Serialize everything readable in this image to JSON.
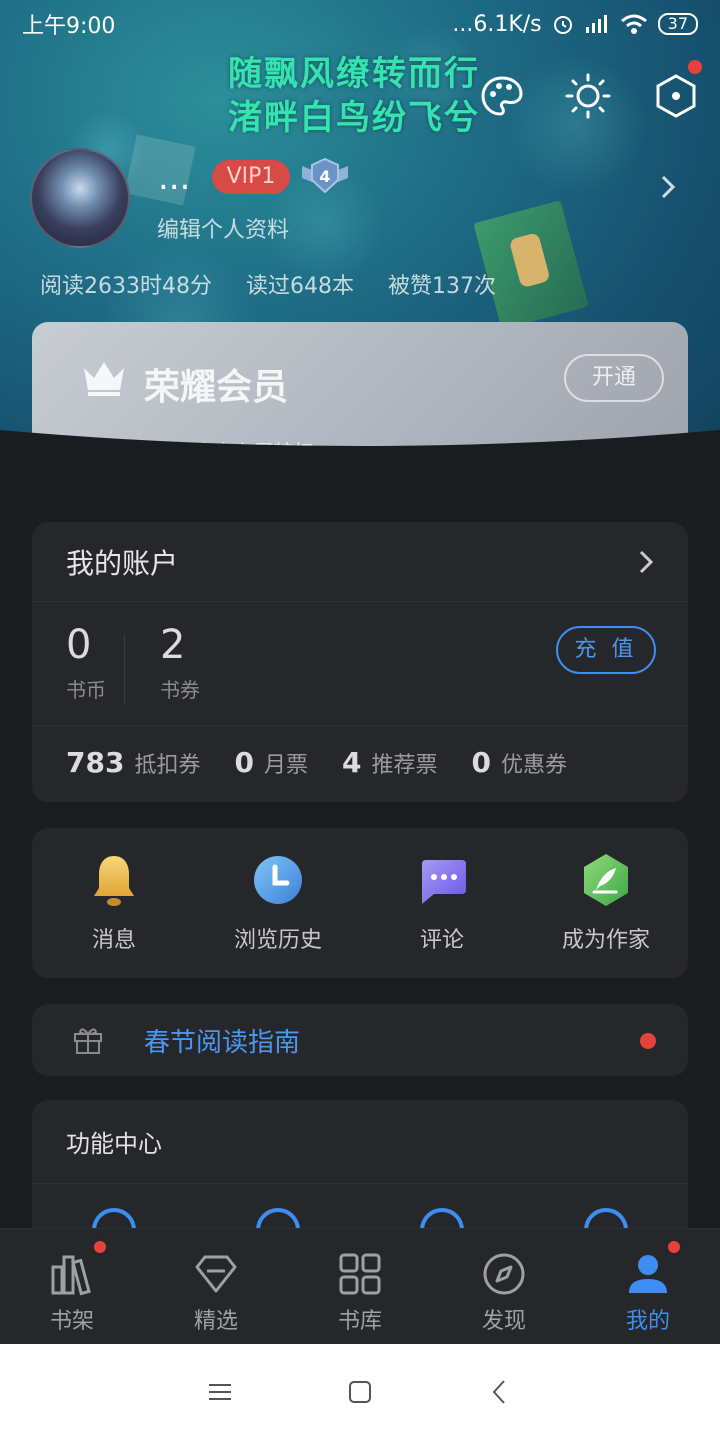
{
  "status": {
    "time": "上午9:00",
    "network": "...6.1K/s",
    "battery": "37"
  },
  "hero": {
    "poem_line1": "随飘风缭转而行",
    "poem_line2": "渚畔白鸟纷飞兮",
    "username": "...",
    "vip_label": "VIP1",
    "level": "4",
    "edit_profile": "编辑个人资料",
    "stats": {
      "read_time": "阅读2633时48分",
      "books_read": "读过648本",
      "likes": "被赞137次"
    }
  },
  "vip_card": {
    "title": "荣耀会员",
    "subtitle": "尊享QQ阅读十大专属特权",
    "button": "开通"
  },
  "account": {
    "title": "我的账户",
    "coins": {
      "value": "0",
      "label": "书币"
    },
    "vouchers": {
      "value": "2",
      "label": "书券"
    },
    "recharge": "充 值",
    "tickets": [
      {
        "value": "783",
        "label": "抵扣券"
      },
      {
        "value": "0",
        "label": "月票"
      },
      {
        "value": "4",
        "label": "推荐票"
      },
      {
        "value": "0",
        "label": "优惠券"
      }
    ]
  },
  "quick": [
    {
      "label": "消息",
      "icon": "bell-icon"
    },
    {
      "label": "浏览历史",
      "icon": "clock-icon"
    },
    {
      "label": "评论",
      "icon": "comment-icon"
    },
    {
      "label": "成为作家",
      "icon": "pen-icon"
    }
  ],
  "guide": {
    "label": "春节阅读指南",
    "icon": "gift-icon"
  },
  "func_center": {
    "title": "功能中心"
  },
  "tabs": [
    {
      "label": "书架",
      "icon": "bookshelf-icon",
      "badge": true,
      "active": false
    },
    {
      "label": "精选",
      "icon": "diamond-icon",
      "badge": false,
      "active": false
    },
    {
      "label": "书库",
      "icon": "grid-icon",
      "badge": false,
      "active": false
    },
    {
      "label": "发现",
      "icon": "compass-icon",
      "badge": false,
      "active": false
    },
    {
      "label": "我的",
      "icon": "user-icon",
      "badge": true,
      "active": true
    }
  ],
  "colors": {
    "accent": "#3d8ef0",
    "badge": "#e8413b",
    "vip": "#d84a45",
    "poem": "#35e3b0"
  }
}
